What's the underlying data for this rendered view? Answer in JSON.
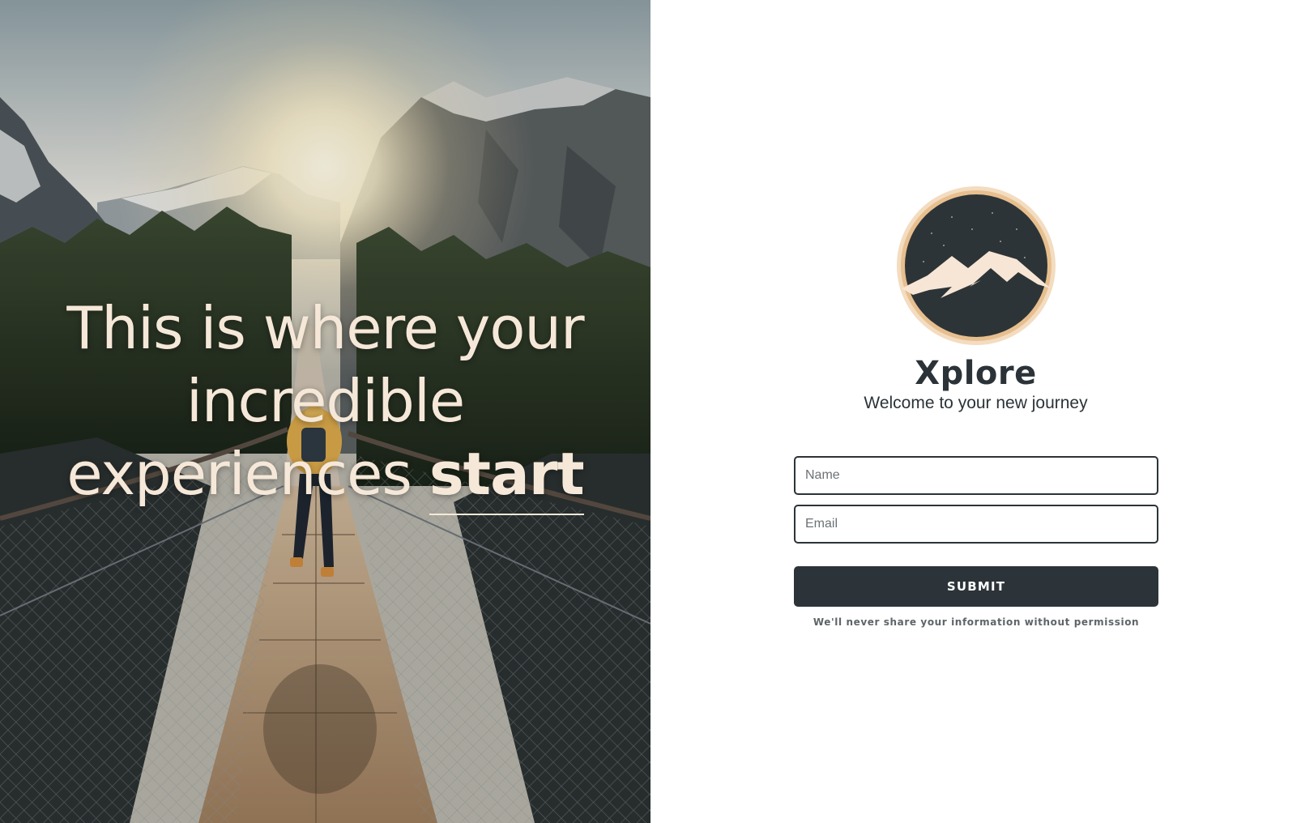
{
  "hero": {
    "headline_line1": "This is where your",
    "headline_line2": "incredible",
    "headline_line3": "experiences",
    "headline_emphasis": "start",
    "image_icon": "suspension-bridge-mountain-photo"
  },
  "brand": {
    "logo_icon": "mountain-logo-icon",
    "name": "Xplore",
    "tagline": "Welcome to your new journey"
  },
  "form": {
    "name_placeholder": "Name",
    "email_placeholder": "Email",
    "submit_label": "SUBMIT",
    "privacy_note": "We'll never share your information without permission"
  },
  "colors": {
    "accent_dark": "#2c3439",
    "hero_text": "#f6e8d8",
    "logo_ring": "#e9c49a",
    "logo_mountain": "#f7e6d6"
  }
}
